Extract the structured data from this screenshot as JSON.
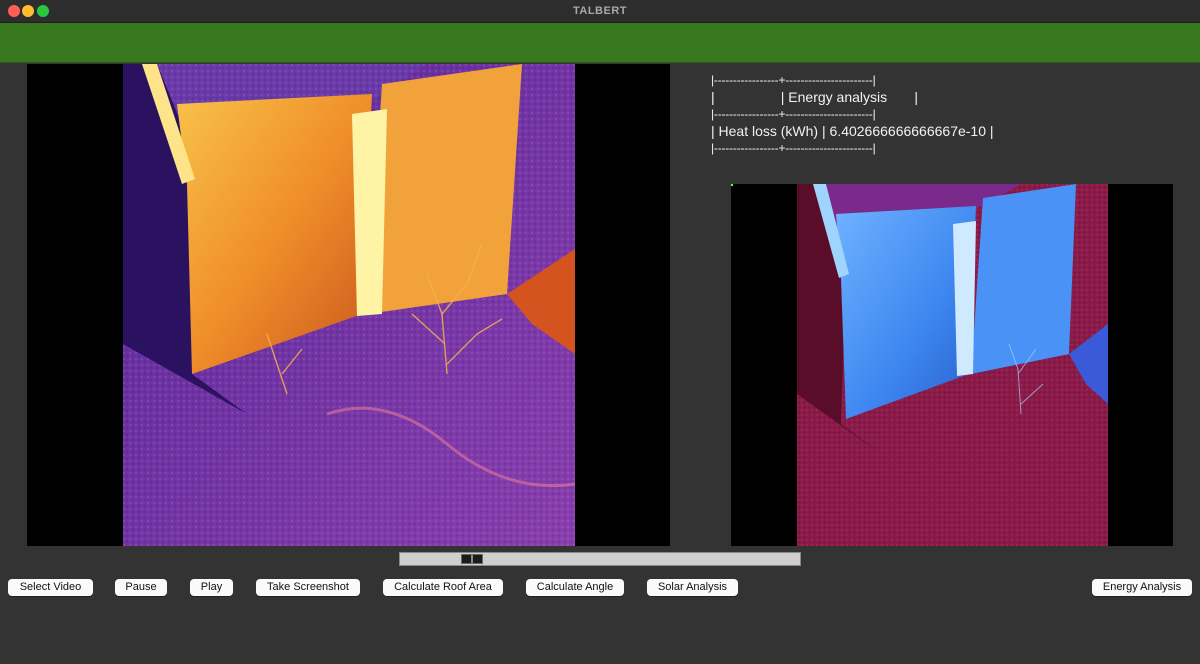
{
  "window": {
    "title": "TALBERT",
    "banner_color": "#38791f"
  },
  "energy_table": {
    "separator": "|-----------------+-----------------------|",
    "header_row": "|                 | Energy analysis       |",
    "data_row": "| Heat loss (kWh) | 6.402666666666667e-10 |"
  },
  "media": {
    "main_video": "thermal-building-inferno-colormap",
    "secondary_video": "thermal-building-blue-red-colormap"
  },
  "controls": {
    "select_video": "Select Video",
    "pause": "Pause",
    "play": "Play",
    "take_screenshot": "Take Screenshot",
    "calculate_roof_area": "Calculate Roof Area",
    "calculate_angle": "Calculate Angle",
    "solar_analysis": "Solar Analysis",
    "energy_analysis": "Energy Analysis"
  },
  "colors": {
    "background": "#333333",
    "thermal_hot": "#f39c2b",
    "thermal_cold": "#3a1a6e",
    "alt_hot": "#3a8ff0",
    "alt_cold": "#8a1430"
  }
}
